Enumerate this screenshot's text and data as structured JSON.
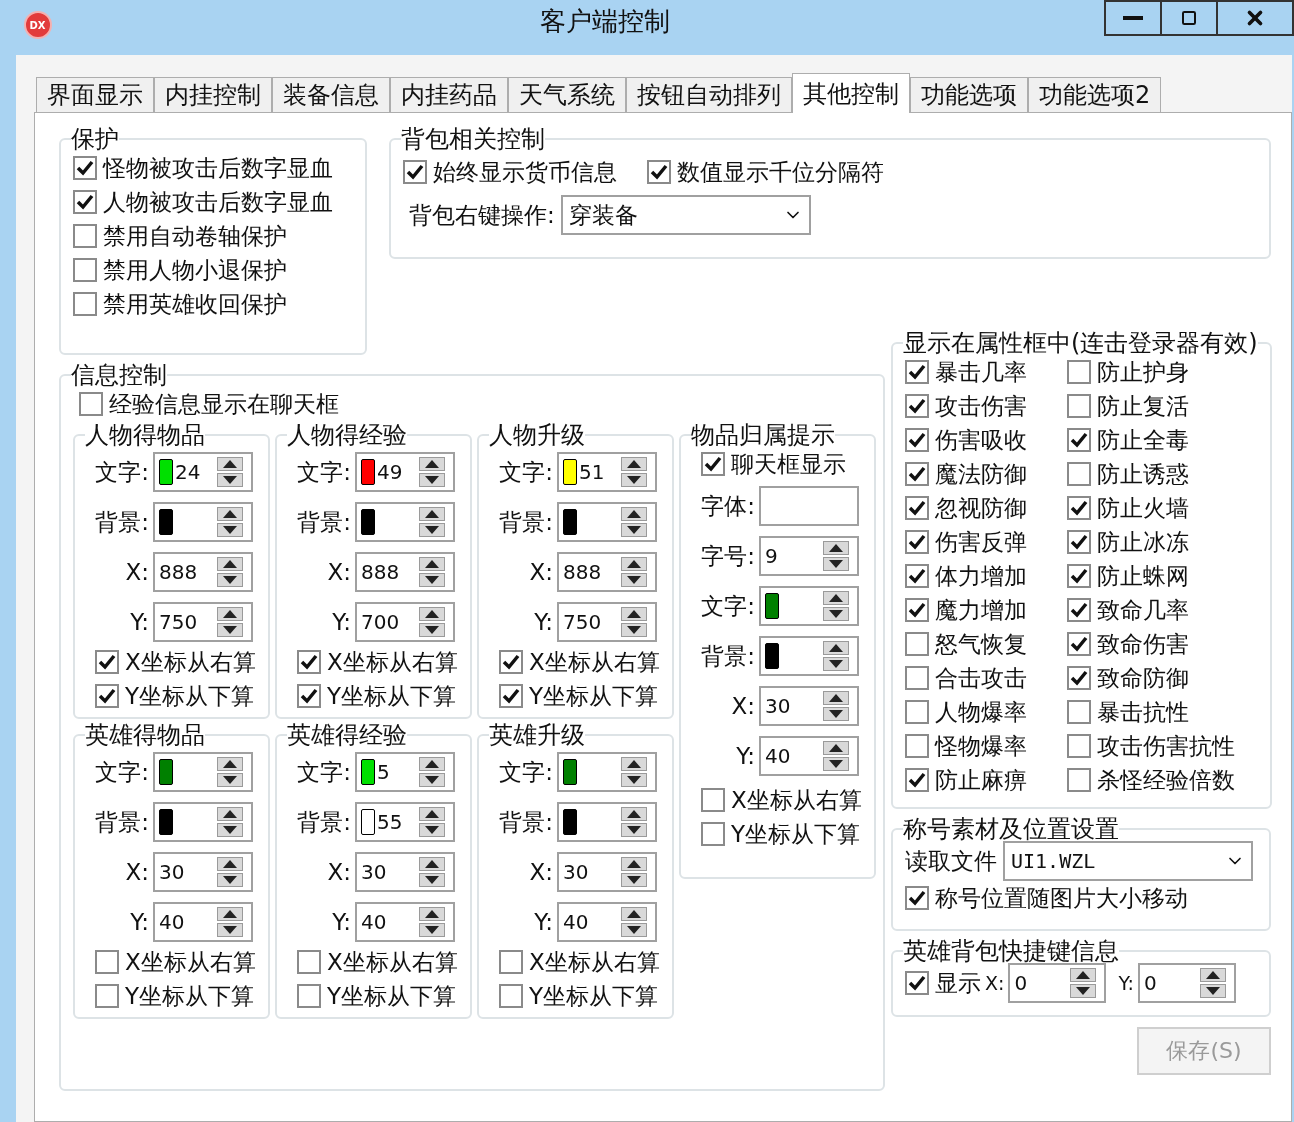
{
  "window": {
    "title": "客户端控制",
    "logo": "DX"
  },
  "tabs": [
    {
      "label": "界面显示",
      "selected": false
    },
    {
      "label": "内挂控制",
      "selected": false
    },
    {
      "label": "装备信息",
      "selected": false
    },
    {
      "label": "内挂药品",
      "selected": false
    },
    {
      "label": "天气系统",
      "selected": false
    },
    {
      "label": "按钮自动排列",
      "selected": false
    },
    {
      "label": "其他控制",
      "selected": true
    },
    {
      "label": "功能选项",
      "selected": false
    },
    {
      "label": "功能选项2",
      "selected": false
    }
  ],
  "protection": {
    "title": "保护",
    "options": [
      {
        "label": "怪物被攻击后数字显血",
        "checked": true
      },
      {
        "label": "人物被攻击后数字显血",
        "checked": true
      },
      {
        "label": "禁用自动卷轴保护",
        "checked": false
      },
      {
        "label": "禁用人物小退保护",
        "checked": false
      },
      {
        "label": "禁用英雄收回保护",
        "checked": false
      }
    ]
  },
  "bag": {
    "title": "背包相关控制",
    "options": [
      {
        "label": "始终显示货币信息",
        "checked": true
      },
      {
        "label": "数值显示千位分隔符",
        "checked": true
      }
    ],
    "right_click": {
      "label": "背包右键操作:",
      "value": "穿装备"
    }
  },
  "info": {
    "title": "信息控制",
    "option": {
      "label": "经验信息显示在聊天框",
      "checked": false
    },
    "panels": [
      {
        "title": "人物得物品",
        "fields": [
          {
            "kind": "color",
            "label": "文字:",
            "color": "#00e000",
            "value": "24"
          },
          {
            "kind": "color",
            "label": "背景:",
            "color": "#000000"
          },
          {
            "kind": "number",
            "label": "X:",
            "value": "888"
          },
          {
            "kind": "number",
            "label": "Y:",
            "value": "750"
          }
        ],
        "options": [
          {
            "label": "X坐标从右算",
            "checked": true
          },
          {
            "label": "Y坐标从下算",
            "checked": true
          }
        ]
      },
      {
        "title": "人物得经验",
        "fields": [
          {
            "kind": "color",
            "label": "文字:",
            "color": "#ff0000",
            "value": "49"
          },
          {
            "kind": "color",
            "label": "背景:",
            "color": "#000000"
          },
          {
            "kind": "number",
            "label": "X:",
            "value": "888"
          },
          {
            "kind": "number",
            "label": "Y:",
            "value": "700"
          }
        ],
        "options": [
          {
            "label": "X坐标从右算",
            "checked": true
          },
          {
            "label": "Y坐标从下算",
            "checked": true
          }
        ]
      },
      {
        "title": "人物升级",
        "fields": [
          {
            "kind": "color",
            "label": "文字:",
            "color": "#ffff00",
            "value": "51"
          },
          {
            "kind": "color",
            "label": "背景:",
            "color": "#000000"
          },
          {
            "kind": "number",
            "label": "X:",
            "value": "888"
          },
          {
            "kind": "number",
            "label": "Y:",
            "value": "750"
          }
        ],
        "options": [
          {
            "label": "X坐标从右算",
            "checked": true
          },
          {
            "label": "Y坐标从下算",
            "checked": true
          }
        ]
      },
      {
        "title": "英雄得物品",
        "fields": [
          {
            "kind": "color",
            "label": "文字:",
            "color": "#008000"
          },
          {
            "kind": "color",
            "label": "背景:",
            "color": "#000000"
          },
          {
            "kind": "number",
            "label": "X:",
            "value": "30"
          },
          {
            "kind": "number",
            "label": "Y:",
            "value": "40"
          }
        ],
        "options": [
          {
            "label": "X坐标从右算",
            "checked": false
          },
          {
            "label": "Y坐标从下算",
            "checked": false
          }
        ]
      },
      {
        "title": "英雄得经验",
        "fields": [
          {
            "kind": "color",
            "label": "文字:",
            "color": "#00e000",
            "value": "5"
          },
          {
            "kind": "color",
            "label": "背景:",
            "color": "#ffffff",
            "value": "55"
          },
          {
            "kind": "number",
            "label": "X:",
            "value": "30"
          },
          {
            "kind": "number",
            "label": "Y:",
            "value": "40"
          }
        ],
        "options": [
          {
            "label": "X坐标从右算",
            "checked": false
          },
          {
            "label": "Y坐标从下算",
            "checked": false
          }
        ]
      },
      {
        "title": "英雄升级",
        "fields": [
          {
            "kind": "color",
            "label": "文字:",
            "color": "#008000"
          },
          {
            "kind": "color",
            "label": "背景:",
            "color": "#000000"
          },
          {
            "kind": "number",
            "label": "X:",
            "value": "30"
          },
          {
            "kind": "number",
            "label": "Y:",
            "value": "40"
          }
        ],
        "options": [
          {
            "label": "X坐标从右算",
            "checked": false
          },
          {
            "label": "Y坐标从下算",
            "checked": false
          }
        ]
      }
    ],
    "ownership": {
      "title": "物品归属提示",
      "option": {
        "label": "聊天框显示",
        "checked": true
      },
      "fields": [
        {
          "kind": "text",
          "label": "字体:"
        },
        {
          "kind": "number",
          "label": "字号:",
          "value": "9"
        },
        {
          "kind": "color",
          "label": "文字:",
          "color": "#008000"
        },
        {
          "kind": "color",
          "label": "背景:",
          "color": "#000000"
        },
        {
          "kind": "number",
          "label": "X:",
          "value": "30"
        },
        {
          "kind": "number",
          "label": "Y:",
          "value": "40"
        }
      ],
      "options": [
        {
          "label": "X坐标从右算",
          "checked": false
        },
        {
          "label": "Y坐标从下算",
          "checked": false
        }
      ]
    }
  },
  "attributes": {
    "title": "显示在属性框中(连击登录器有效)",
    "columns": [
      [
        {
          "label": "暴击几率",
          "checked": true
        },
        {
          "label": "攻击伤害",
          "checked": true
        },
        {
          "label": "伤害吸收",
          "checked": true
        },
        {
          "label": "魔法防御",
          "checked": true
        },
        {
          "label": "忽视防御",
          "checked": true
        },
        {
          "label": "伤害反弹",
          "checked": true
        },
        {
          "label": "体力增加",
          "checked": true
        },
        {
          "label": "魔力增加",
          "checked": true
        },
        {
          "label": "怒气恢复",
          "checked": false
        },
        {
          "label": "合击攻击",
          "checked": false
        },
        {
          "label": "人物爆率",
          "checked": false
        },
        {
          "label": "怪物爆率",
          "checked": false
        },
        {
          "label": "防止麻痹",
          "checked": true
        }
      ],
      [
        {
          "label": "防止护身",
          "checked": false
        },
        {
          "label": "防止复活",
          "checked": false
        },
        {
          "label": "防止全毒",
          "checked": true
        },
        {
          "label": "防止诱惑",
          "checked": false
        },
        {
          "label": "防止火墙",
          "checked": true
        },
        {
          "label": "防止冰冻",
          "checked": true
        },
        {
          "label": "防止蛛网",
          "checked": true
        },
        {
          "label": "致命几率",
          "checked": true
        },
        {
          "label": "致命伤害",
          "checked": true
        },
        {
          "label": "致命防御",
          "checked": true
        },
        {
          "label": "暴击抗性",
          "checked": false
        },
        {
          "label": "攻击伤害抗性",
          "checked": false
        },
        {
          "label": "杀怪经验倍数",
          "checked": false
        }
      ]
    ]
  },
  "title_asset": {
    "title": "称号素材及位置设置",
    "file_label": "读取文件",
    "file": "UI1.WZL",
    "option": {
      "label": "称号位置随图片大小移动",
      "checked": true
    }
  },
  "hero_bag": {
    "title": "英雄背包快捷键信息",
    "option": {
      "label": "显示",
      "checked": true
    },
    "x": {
      "label": "X:",
      "value": "0"
    },
    "y": {
      "label": "Y:",
      "value": "0"
    }
  },
  "save": {
    "label": "保存(S)",
    "disabled": true
  }
}
